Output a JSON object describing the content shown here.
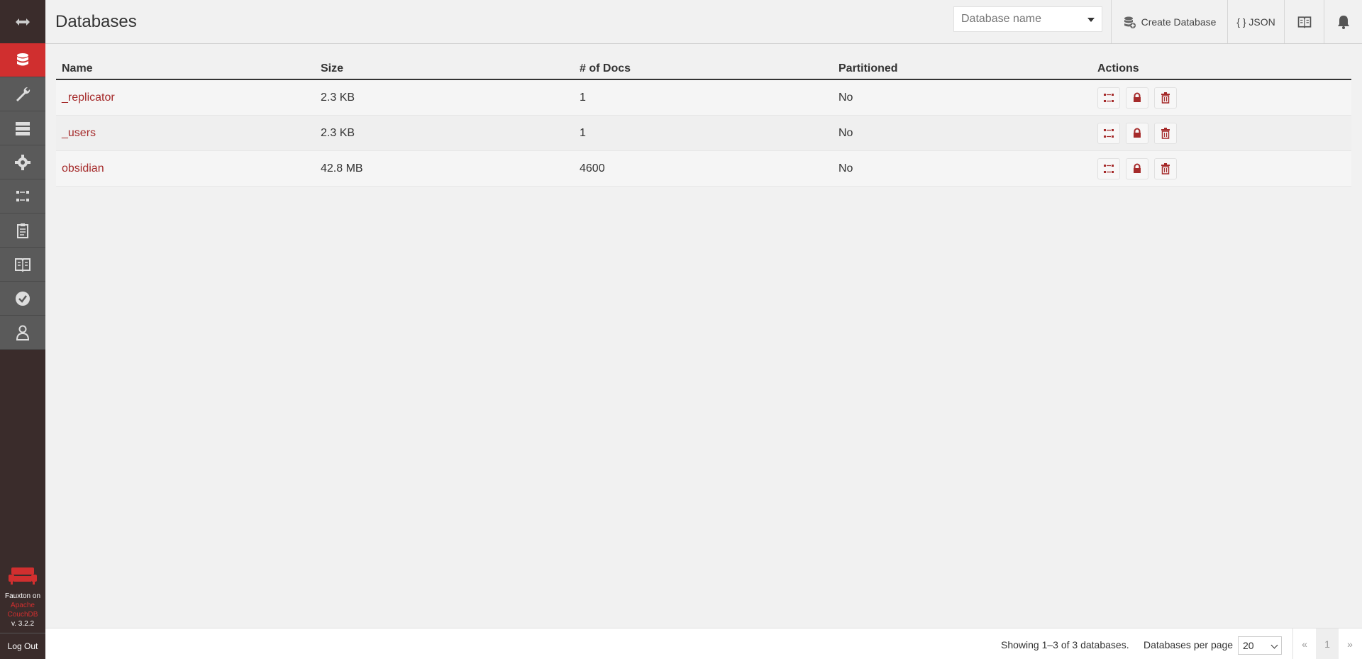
{
  "app": {
    "brand_line1": "Fauxton on",
    "brand_line2": "Apache",
    "brand_line3": "CouchDB",
    "version": "v. 3.2.2",
    "logout_label": "Log Out"
  },
  "sidebar": {
    "items": [
      {
        "name": "databases",
        "icon": "database-icon",
        "active": true
      },
      {
        "name": "setup",
        "icon": "wrench-icon",
        "active": false
      },
      {
        "name": "active-tasks",
        "icon": "server-icon",
        "active": false
      },
      {
        "name": "config",
        "icon": "gear-icon",
        "active": false
      },
      {
        "name": "replication",
        "icon": "replication-icon",
        "active": false
      },
      {
        "name": "logs",
        "icon": "clipboard-icon",
        "active": false
      },
      {
        "name": "documentation",
        "icon": "book-icon",
        "active": false
      },
      {
        "name": "verify",
        "icon": "check-circle-icon",
        "active": false
      },
      {
        "name": "user",
        "icon": "user-icon",
        "active": false
      }
    ]
  },
  "header": {
    "title": "Databases",
    "search_placeholder": "Database name",
    "create_db_label": "Create Database",
    "json_label": "{ } JSON"
  },
  "table": {
    "headers": {
      "name": "Name",
      "size": "Size",
      "docs": "# of Docs",
      "partitioned": "Partitioned",
      "actions": "Actions"
    },
    "rows": [
      {
        "name": "_replicator",
        "size": "2.3 KB",
        "docs": "1",
        "partitioned": "No"
      },
      {
        "name": "_users",
        "size": "2.3 KB",
        "docs": "1",
        "partitioned": "No"
      },
      {
        "name": "obsidian",
        "size": "42.8 MB",
        "docs": "4600",
        "partitioned": "No"
      }
    ]
  },
  "footer": {
    "showing": "Showing 1–3 of 3 databases.",
    "per_page_label": "Databases per page",
    "per_page_value": "20",
    "prev": "«",
    "page": "1",
    "next": "»"
  },
  "colors": {
    "accent": "#d02f2f",
    "sidebar_bg": "#3a2c2b",
    "link": "#a52a2a"
  }
}
